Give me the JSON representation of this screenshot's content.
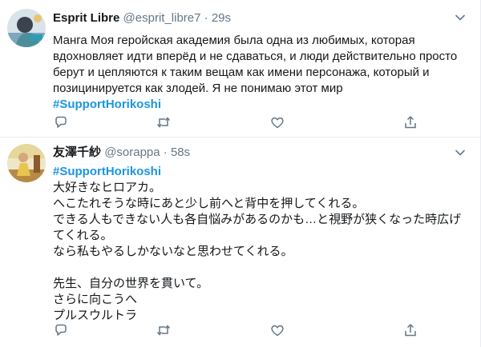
{
  "tweets": [
    {
      "name": "Esprit Libre",
      "handle": "@esprit_libre7",
      "dot": "·",
      "time": "29s",
      "lines": [
        "Манга Моя геройская академия была одна из любимых, которая",
        "вдохновляет идти вперёд и не сдаваться, и люди действительно просто",
        "берут и цепляются к таким вещам как имени персонажа, который и",
        "позицинируется как злодей. Я не понимаю этот мир"
      ],
      "hashtag": "#SupportHorikoshi",
      "icons": [
        "reply-icon",
        "retweet-icon",
        "like-icon",
        "share-icon"
      ]
    },
    {
      "name": "友澤千紗",
      "handle": "@sorappa",
      "dot": "·",
      "time": "58s",
      "hashtag": "#SupportHorikoshi",
      "lines": [
        "大好きなヒロアカ。",
        "へこたれそうな時にあと少し前へと背中を押してくれる。",
        "できる人もできない人も各自悩みがあるのかも…と視野が狭くなった時広げ",
        "てくれる。",
        "なら私もやるしかないなと思わせてくれる。",
        "",
        "先生、自分の世界を貫いて。",
        "さらに向こうへ",
        "プルスウルトラ"
      ],
      "icons": [
        "reply-icon",
        "retweet-icon",
        "like-icon",
        "share-icon"
      ]
    }
  ],
  "colors": {
    "hashtag": "#1b95e0",
    "secondary_text": "#657786",
    "icon": "#657786",
    "divider": "#e6ecf0"
  }
}
